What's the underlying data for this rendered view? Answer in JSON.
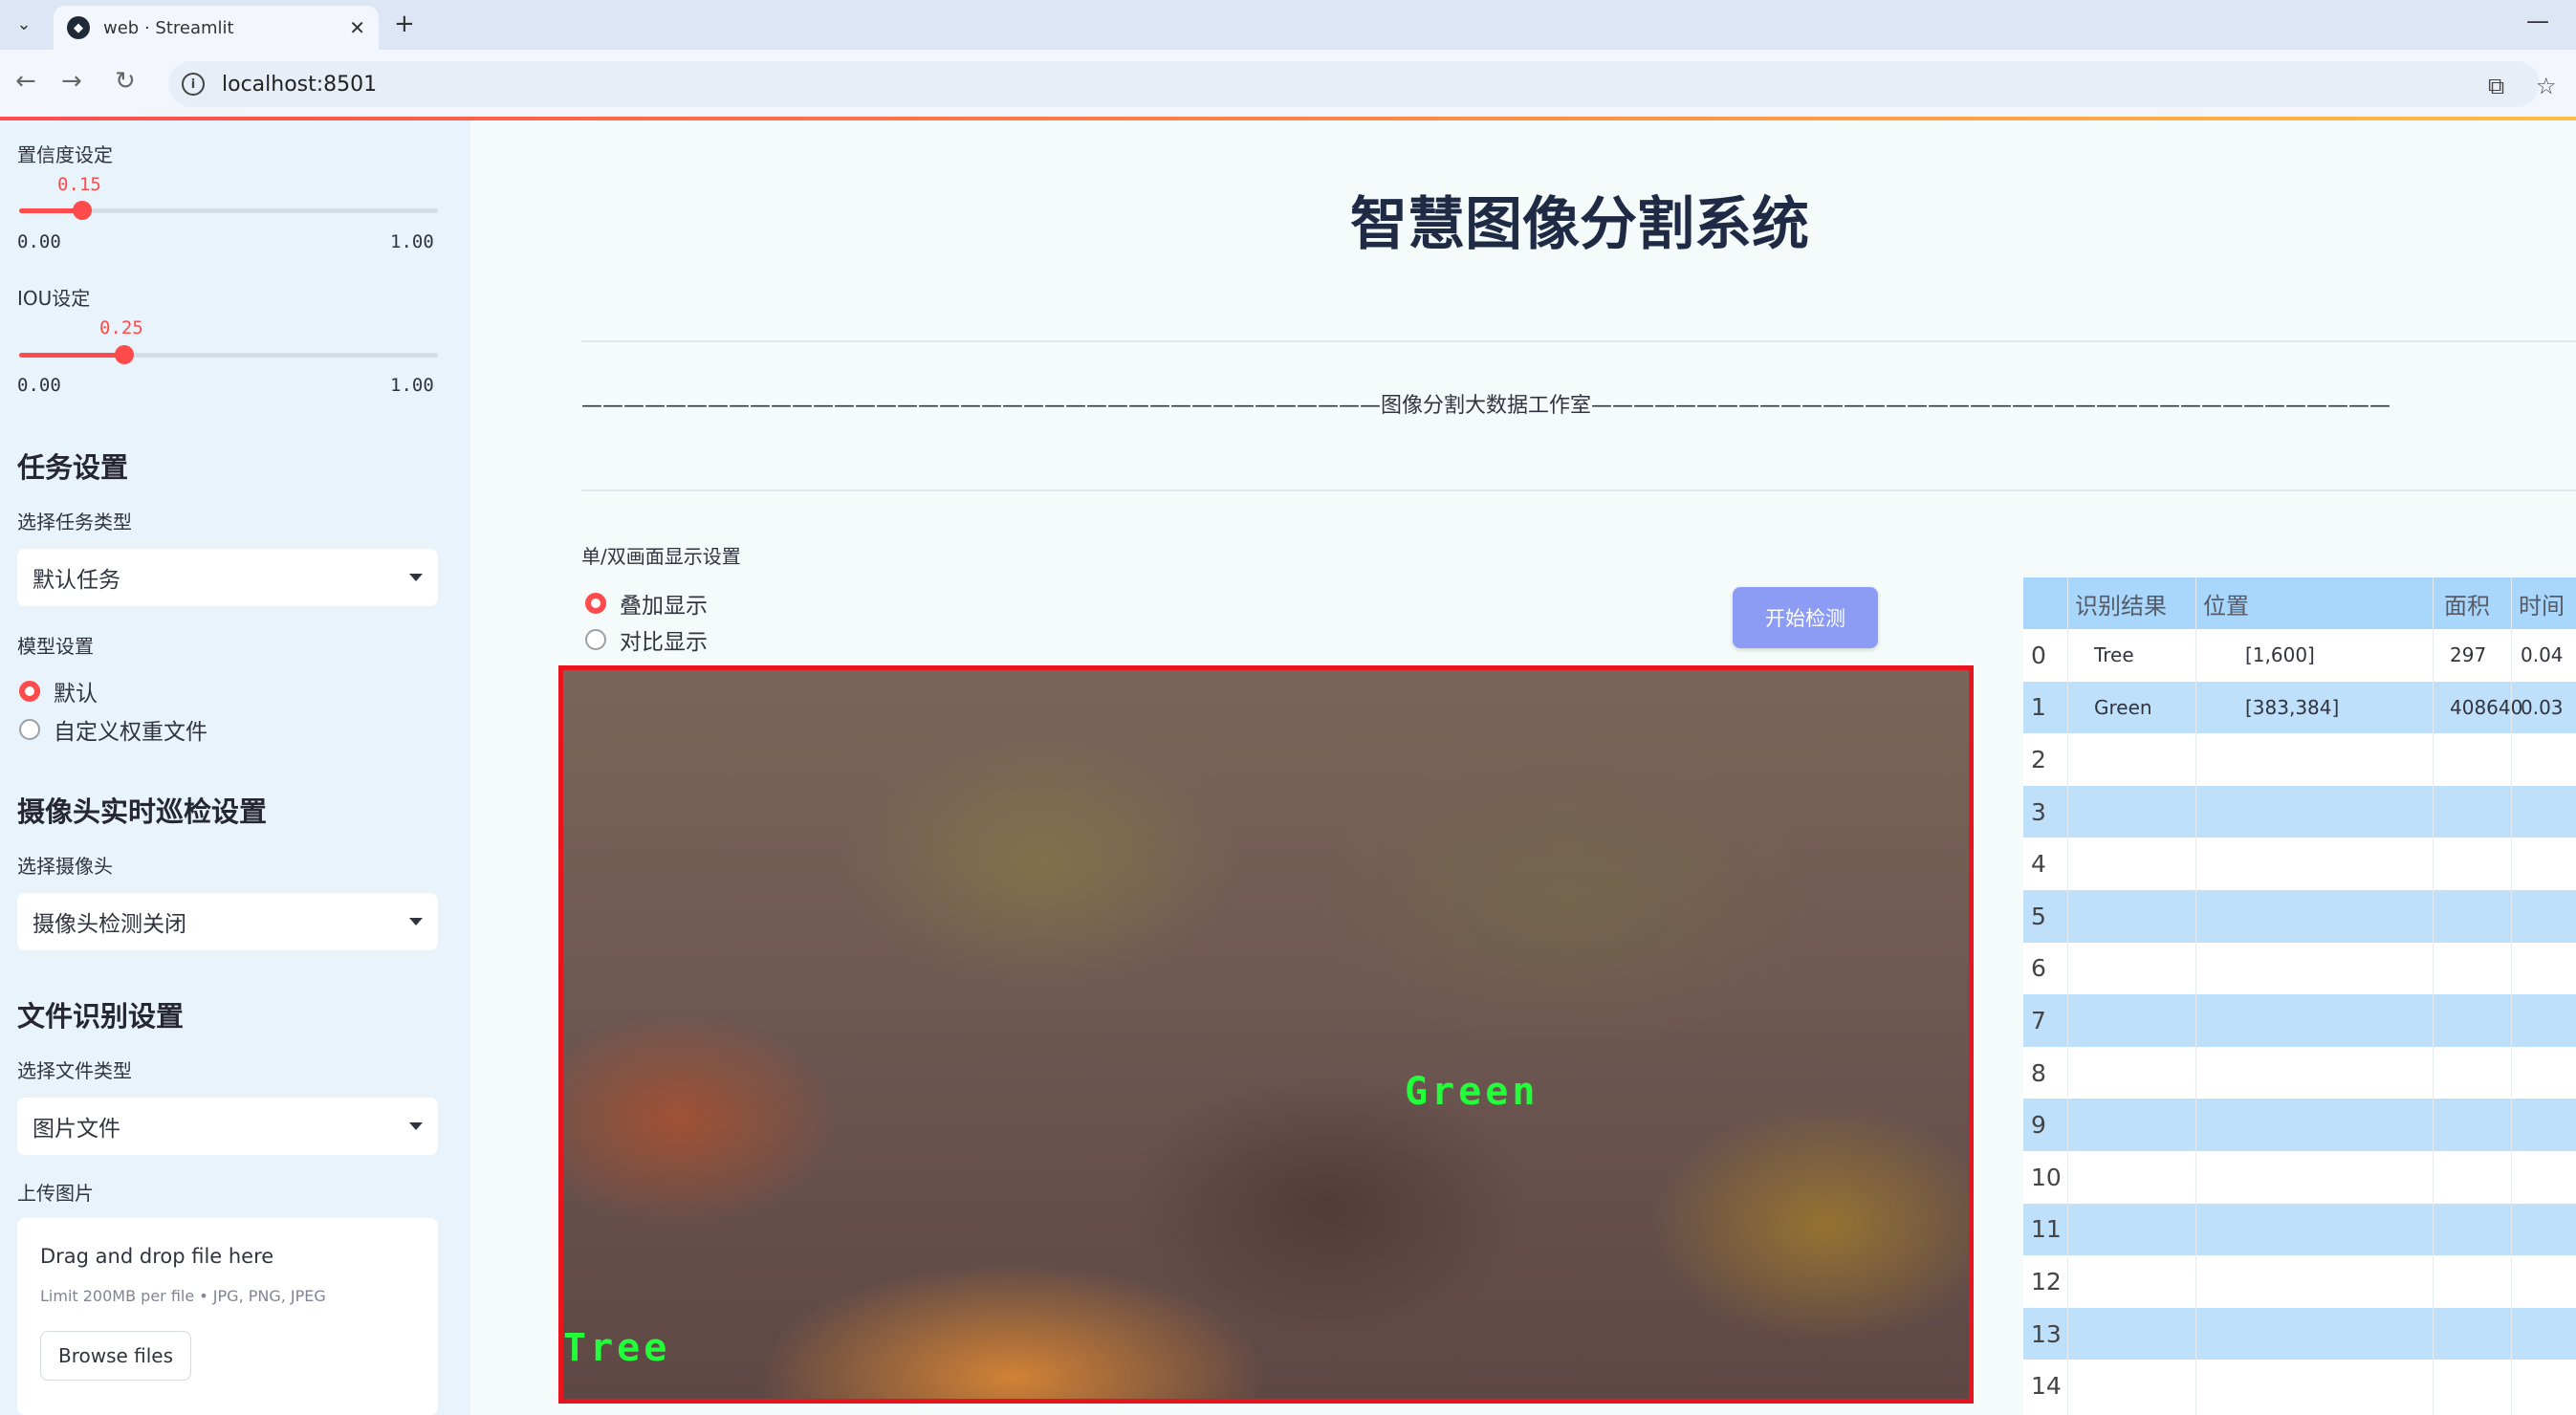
{
  "browser": {
    "tab_title": "web · Streamlit",
    "url": "localhost:8501"
  },
  "sidebar": {
    "confidence": {
      "label": "置信度设定",
      "value": "0.15",
      "fraction": 0.15,
      "min": "0.00",
      "max": "1.00"
    },
    "iou": {
      "label": "IOU设定",
      "value": "0.25",
      "fraction": 0.25,
      "min": "0.00",
      "max": "1.00"
    },
    "task_section": {
      "heading": "任务设置",
      "select_label": "选择任务类型",
      "selected": "默认任务"
    },
    "model_section": {
      "label": "模型设置",
      "options": [
        "默认",
        "自定义权重文件"
      ],
      "selected_index": 0
    },
    "camera_section": {
      "heading": "摄像头实时巡检设置",
      "select_label": "选择摄像头",
      "selected": "摄像头检测关闭"
    },
    "file_section": {
      "heading": "文件识别设置",
      "select_label": "选择文件类型",
      "selected": "图片文件"
    },
    "upload": {
      "label": "上传图片",
      "title": "Drag and drop file here",
      "subtitle": "Limit 200MB per file • JPG, PNG, JPEG",
      "button": "Browse files"
    }
  },
  "main": {
    "title": "智慧图像分割系统",
    "divider_text": "——————————————————————————————————————图像分割大数据工作室——————————————————————————————————————",
    "display_mode": {
      "label": "单/双画面显示设置",
      "options": [
        "叠加显示",
        "对比显示"
      ],
      "selected_index": 0
    },
    "start_button": "开始检测",
    "detections": [
      {
        "label": "Green"
      },
      {
        "label": "Tree"
      }
    ]
  },
  "results_table": {
    "columns": [
      "识别结果",
      "位置",
      "面积",
      "时间"
    ],
    "rows": [
      {
        "index": "0",
        "result": "Tree",
        "position": "[1,600]",
        "area": "297",
        "time": "0.04"
      },
      {
        "index": "1",
        "result": "Green",
        "position": "[383,384]",
        "area": "408640",
        "time": "0.03"
      },
      {
        "index": "2"
      },
      {
        "index": "3"
      },
      {
        "index": "4"
      },
      {
        "index": "5"
      },
      {
        "index": "6"
      },
      {
        "index": "7"
      },
      {
        "index": "8"
      },
      {
        "index": "9"
      },
      {
        "index": "10"
      },
      {
        "index": "11"
      },
      {
        "index": "12"
      },
      {
        "index": "13"
      },
      {
        "index": "14"
      }
    ]
  },
  "colors": {
    "accent": "#ff4b4b",
    "button": "#8c9cf5",
    "frame_border": "#e8141e",
    "label_green": "#22ff3a"
  }
}
